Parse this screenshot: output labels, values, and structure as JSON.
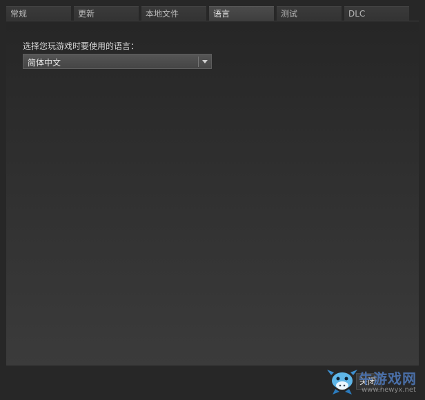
{
  "tabs": [
    {
      "label": "常规",
      "active": false
    },
    {
      "label": "更新",
      "active": false
    },
    {
      "label": "本地文件",
      "active": false
    },
    {
      "label": "语言",
      "active": true
    },
    {
      "label": "测试",
      "active": false
    },
    {
      "label": "DLC",
      "active": false
    }
  ],
  "language": {
    "label": "选择您玩游戏时要使用的语言：",
    "selected": "简体中文"
  },
  "footer": {
    "close_label": "关闭"
  },
  "watermark": {
    "text": "牛游戏网",
    "url": "www.newyx.net",
    "color": "#4a6fa8"
  },
  "colors": {
    "background": "#272727",
    "tab_active": "#4b4b4b",
    "tab_inactive": "#3a3a3a"
  }
}
